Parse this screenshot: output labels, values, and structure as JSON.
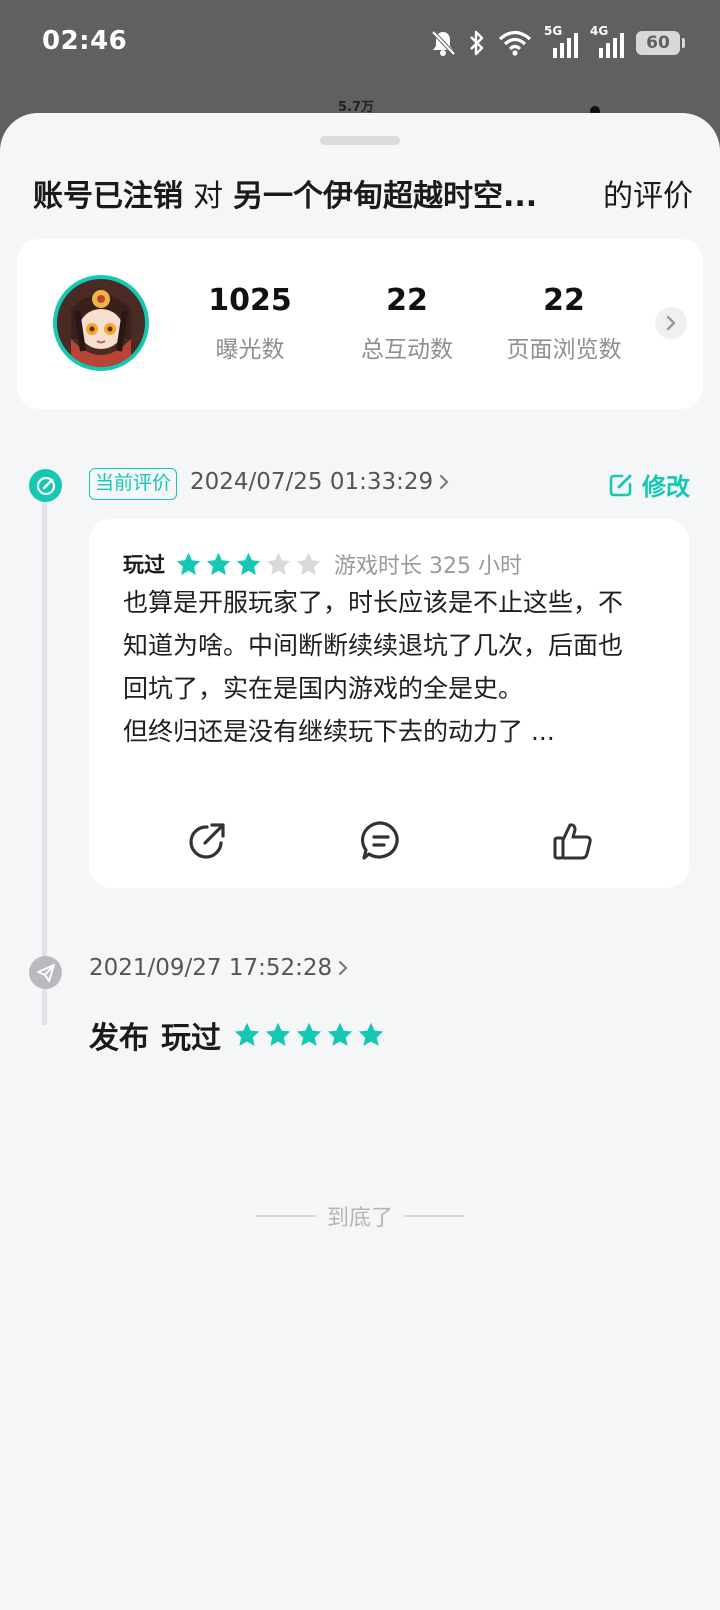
{
  "status_bar": {
    "time": "02:46",
    "network_5g": "5G",
    "network_4g": "4G",
    "battery": "60"
  },
  "background_peek": "5.7万",
  "sheet": {
    "title": {
      "user": "账号已注销",
      "conjunction": "对",
      "game": "另一个伊甸超越时空...",
      "suffix": "的评价"
    },
    "stats": [
      {
        "value": "1025",
        "label": "曝光数"
      },
      {
        "value": "22",
        "label": "总互动数"
      },
      {
        "value": "22",
        "label": "页面浏览数"
      }
    ],
    "current_review": {
      "tag": "当前评价",
      "timestamp": "2024/07/25 01:33:29",
      "edit_label": "修改",
      "status": "玩过",
      "rating": 3,
      "rating_max": 5,
      "playtime": "游戏时长 325 小时",
      "text": "也算是开服玩家了，时长应该是不止这些，不知道为啥。中间断断续续退坑了几次，后面也回坑了，实在是国内游戏的全是史。\n但终归还是没有继续玩下去的动力了 ..."
    },
    "past_review": {
      "timestamp": "2021/09/27 17:52:28",
      "action": "发布",
      "status": "玩过",
      "rating": 5,
      "rating_max": 5
    },
    "end_text": "到底了"
  },
  "colors": {
    "accent": "#14c8b4",
    "star_empty": "#d9d9d9",
    "sheet_background": "#f5f6f8",
    "backdrop": "#5f6062"
  }
}
